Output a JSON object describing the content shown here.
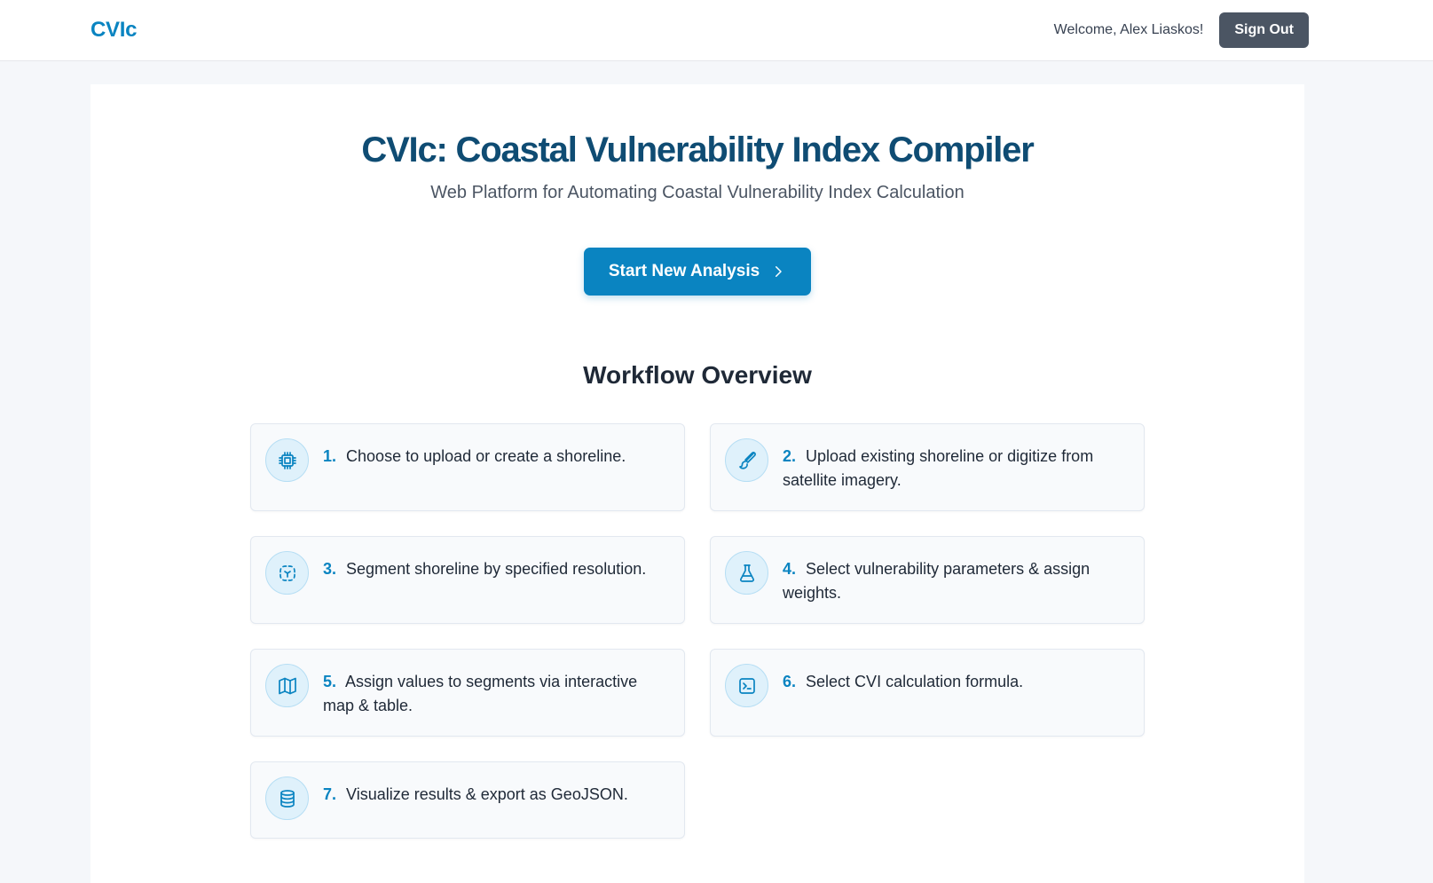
{
  "header": {
    "brand": "CVIc",
    "welcome": "Welcome, Alex Liaskos!",
    "sign_out_label": "Sign Out"
  },
  "hero": {
    "title": "CVIc: Coastal Vulnerability Index Compiler",
    "subtitle": "Web Platform for Automating Coastal Vulnerability Index Calculation",
    "cta_label": "Start New Analysis",
    "cta_icon": "chevron-right-icon"
  },
  "workflow": {
    "title": "Workflow Overview",
    "steps": [
      {
        "num": "1.",
        "text": "Choose to upload or create a shoreline.",
        "icon": "cpu-chip-icon"
      },
      {
        "num": "2.",
        "text": "Upload existing shoreline or digitize from satellite imagery.",
        "icon": "paintbrush-icon"
      },
      {
        "num": "3.",
        "text": "Segment shoreline by specified resolution.",
        "icon": "scan-segment-icon"
      },
      {
        "num": "4.",
        "text": "Select vulnerability parameters & assign weights.",
        "icon": "flask-icon"
      },
      {
        "num": "5.",
        "text": "Assign values to segments via interactive map & table.",
        "icon": "map-icon"
      },
      {
        "num": "6.",
        "text": "Select CVI calculation formula.",
        "icon": "terminal-icon"
      },
      {
        "num": "7.",
        "text": "Visualize results & export as GeoJSON.",
        "icon": "database-icon"
      }
    ]
  },
  "colors": {
    "accent": "#0a84c1",
    "title": "#0f4c73",
    "sign_out_bg": "#4b5563"
  }
}
